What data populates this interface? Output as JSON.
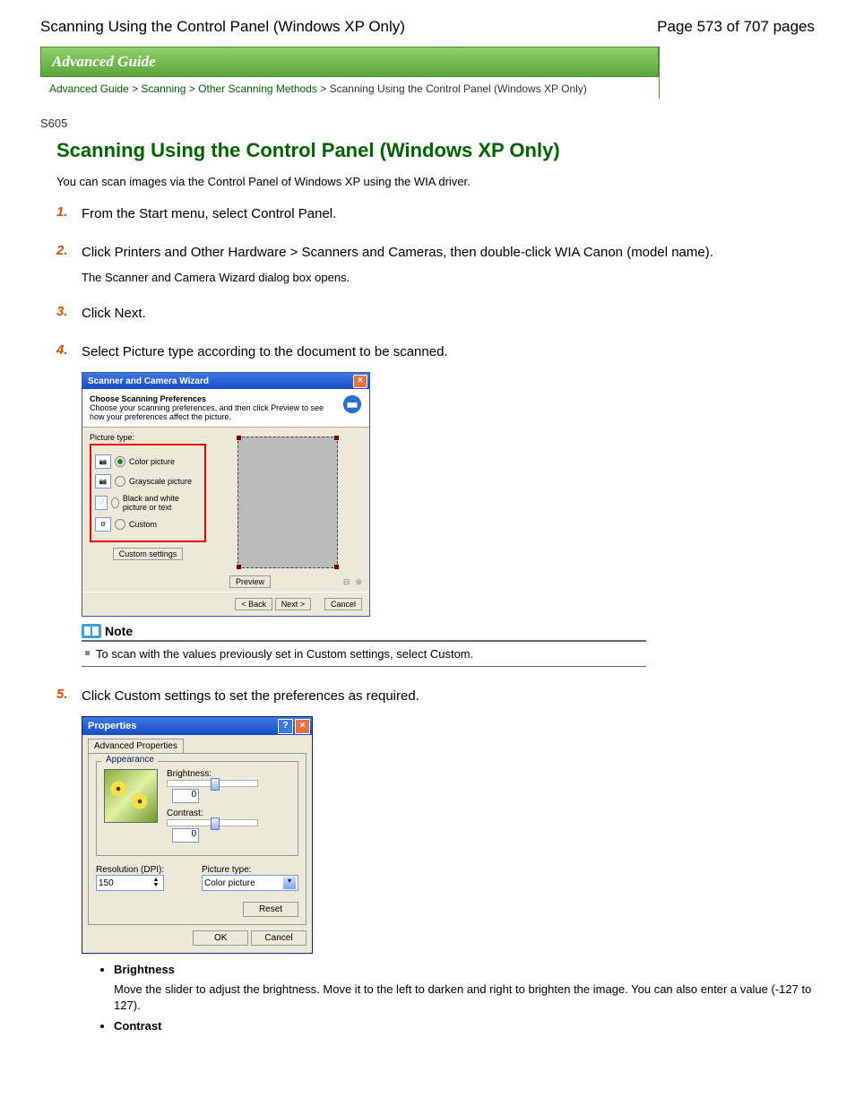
{
  "page": {
    "header_title": "Scanning Using the Control Panel (Windows XP Only)",
    "page_indicator": "Page 573 of 707 pages",
    "guide_banner": "Advanced Guide",
    "doc_id": "S605"
  },
  "breadcrumb": {
    "root": "Advanced Guide",
    "seg1": "Scanning",
    "seg2": "Other Scanning Methods",
    "current": "Scanning Using the Control Panel (Windows XP Only)",
    "sep": " > "
  },
  "content": {
    "title": "Scanning Using the Control Panel (Windows XP Only)",
    "intro": "You can scan images via the Control Panel of Windows XP using the WIA driver."
  },
  "steps": {
    "s1": {
      "num": "1.",
      "title": "From the Start menu, select Control Panel."
    },
    "s2": {
      "num": "2.",
      "title": "Click Printers and Other Hardware > Scanners and Cameras, then double-click WIA Canon (model name).",
      "desc": "The Scanner and Camera Wizard dialog box opens."
    },
    "s3": {
      "num": "3.",
      "title": "Click Next."
    },
    "s4": {
      "num": "4.",
      "title": "Select Picture type according to the document to be scanned."
    },
    "s5": {
      "num": "5.",
      "title": "Click Custom settings to set the preferences as required."
    }
  },
  "wizard": {
    "title": "Scanner and Camera Wizard",
    "header_title": "Choose Scanning Preferences",
    "header_desc": "Choose your scanning preferences, and then click Preview to see how your preferences affect the picture.",
    "pt_label": "Picture type:",
    "opt_color": "Color picture",
    "opt_gray": "Grayscale picture",
    "opt_bw": "Black and white picture or text",
    "opt_custom": "Custom",
    "btn_custom": "Custom settings",
    "btn_preview": "Preview",
    "btn_back": "< Back",
    "btn_next": "Next >",
    "btn_cancel": "Cancel"
  },
  "note": {
    "title": "Note",
    "body": "To scan with the values previously set in Custom settings, select Custom."
  },
  "properties": {
    "title": "Properties",
    "tab": "Advanced Properties",
    "group": "Appearance",
    "brightness_label": "Brightness:",
    "brightness_value": "0",
    "contrast_label": "Contrast:",
    "contrast_value": "0",
    "resolution_label": "Resolution (DPI):",
    "resolution_value": "150",
    "picture_type_label": "Picture type:",
    "picture_type_value": "Color picture",
    "btn_reset": "Reset",
    "btn_ok": "OK",
    "btn_cancel": "Cancel"
  },
  "definitions": {
    "brightness": {
      "title": "Brightness",
      "body": "Move the slider to adjust the brightness. Move it to the left to darken and right to brighten the image. You can also enter a value (-127 to 127)."
    },
    "contrast": {
      "title": "Contrast"
    }
  }
}
